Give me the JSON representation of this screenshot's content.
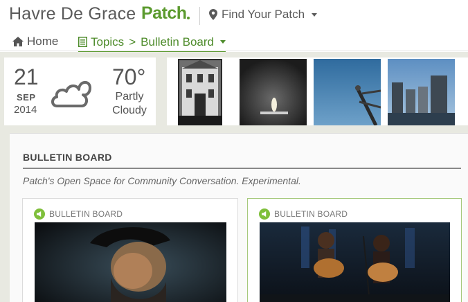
{
  "header": {
    "site_name": "Havre De Grace",
    "brand": "Patch",
    "find_patch": "Find Your Patch"
  },
  "nav": {
    "home": "Home",
    "topics": "Topics",
    "separator": ">",
    "current": "Bulletin Board"
  },
  "weather": {
    "day": "21",
    "month": "SEP",
    "year": "2014",
    "temperature": "70°",
    "condition_line1": "Partly",
    "condition_line2": "Cloudy",
    "icon": "cloud-icon"
  },
  "photos": [
    {
      "icon": "building-photo"
    },
    {
      "icon": "candle-photo"
    },
    {
      "icon": "sky-photo"
    },
    {
      "icon": "harbor-photo"
    }
  ],
  "section": {
    "title": "BULLETIN BOARD",
    "description": "Patch's Open Space for Community Conversation. Experimental."
  },
  "cards": [
    {
      "label": "BULLETIN BOARD",
      "icon": "megaphone-icon"
    },
    {
      "label": "BULLETIN BOARD",
      "icon": "megaphone-icon"
    }
  ],
  "colors": {
    "brand_green": "#5b9a2e",
    "band_gray": "#e8e9e1"
  }
}
